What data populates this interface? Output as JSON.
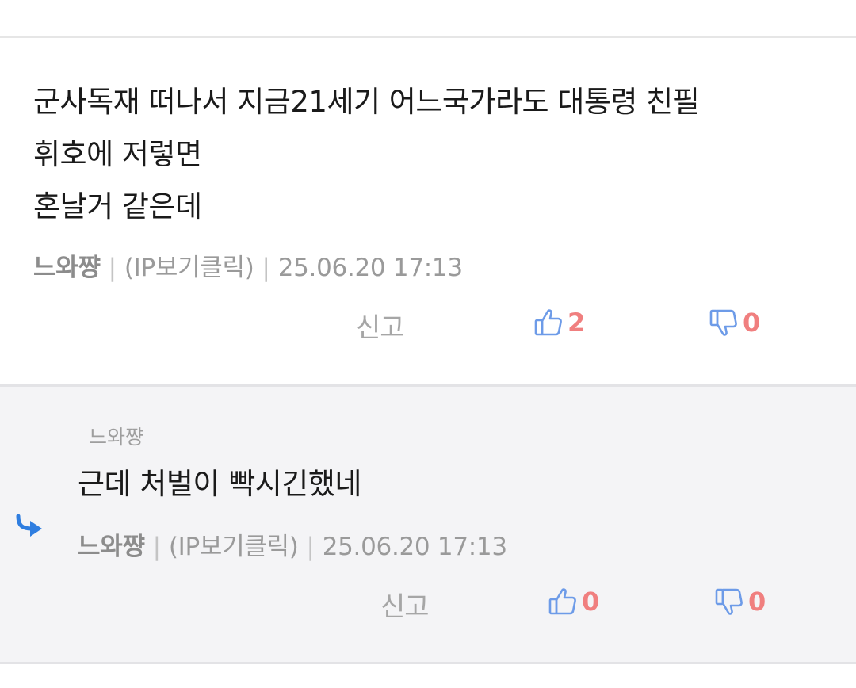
{
  "comment": {
    "lines": [
      "군사독재 떠나서 지금21세기 어느국가라도 대통령  친필",
      "휘호에 저렇면",
      "혼날거 같은데"
    ],
    "author": "느와쨩",
    "ip_label": "(IP보기클릭)",
    "timestamp": "25.06.20 17:13",
    "report_label": "신고",
    "upvotes": "2",
    "downvotes": "0"
  },
  "reply": {
    "reply_to": "느와쨩",
    "text": "근데 처벌이 빡시긴했네",
    "author": "느와쨩",
    "ip_label": "(IP보기클릭)",
    "timestamp": "25.06.20 17:13",
    "report_label": "신고",
    "upvotes": "0",
    "downvotes": "0"
  },
  "separator": "|",
  "icons": {
    "upvote": "thumbs-up-icon",
    "downvote": "thumbs-down-icon",
    "reply": "reply-arrow-icon"
  },
  "colors": {
    "vote_icon": "#6d9be8",
    "vote_count": "#f07f7f",
    "reply_arrow": "#2f7ee0",
    "reply_background": "#f4f4f6"
  }
}
